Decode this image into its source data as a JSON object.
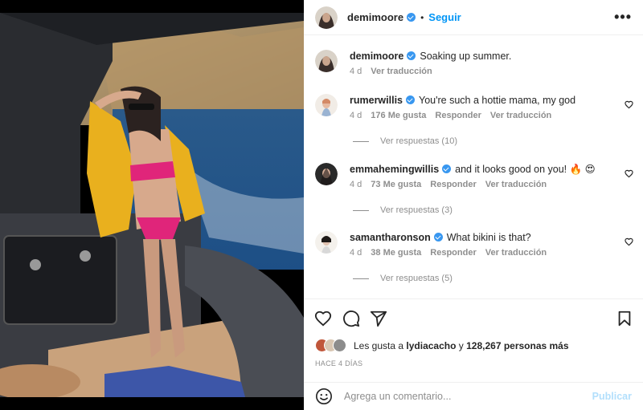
{
  "post": {
    "username": "demimoore",
    "follow_label": "Seguir",
    "more_label": "•••",
    "caption": {
      "username": "demimoore",
      "text": "Soaking up summer.",
      "age": "4 d",
      "translate": "Ver traducción"
    }
  },
  "comments": [
    {
      "username": "rumerwillis",
      "text": "You're such a hottie mama, my god",
      "age": "4 d",
      "likes": "176 Me gusta",
      "reply": "Responder",
      "translate": "Ver traducción",
      "replies": "Ver respuestas (10)"
    },
    {
      "username": "emmahemingwillis",
      "text": "and it looks good on you! 🔥 😍",
      "age": "4 d",
      "likes": "73 Me gusta",
      "reply": "Responder",
      "translate": "Ver traducción",
      "replies": "Ver respuestas (3)"
    },
    {
      "username": "samantharonson",
      "text": "What bikini is that?",
      "age": "4 d",
      "likes": "38 Me gusta",
      "reply": "Responder",
      "translate": "Ver traducción",
      "replies": "Ver respuestas (5)"
    }
  ],
  "likes_summary": {
    "prefix": "Les gusta a",
    "user": "lydiacacho",
    "connector": "y",
    "count": "128,267 personas más"
  },
  "timestamp": "HACE 4 DÍAS",
  "composer": {
    "placeholder": "Agrega un comentario...",
    "publish_label": "Publicar"
  },
  "colors": {
    "accent": "#0095f6",
    "verified": "#3897f0",
    "muted": "#8e8e8e",
    "publish_disabled": "#b2dffc"
  }
}
